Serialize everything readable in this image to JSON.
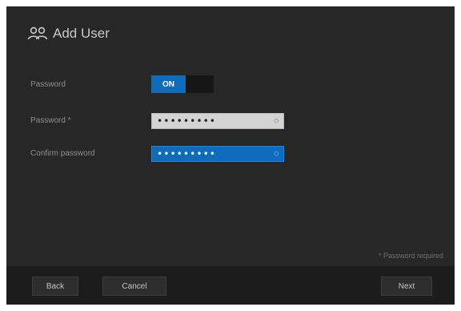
{
  "dialog": {
    "title": "Add User",
    "title_icon": "users-icon",
    "background": "#272727"
  },
  "form": {
    "password_toggle": {
      "label": "Password",
      "on_label": "ON",
      "off_label": "",
      "state": "on"
    },
    "password": {
      "label": "Password *",
      "value": "•••••••••"
    },
    "confirm_password": {
      "label": "Confirm password",
      "value": "•••••••••"
    }
  },
  "note": "* Password required",
  "footer": {
    "back_label": "Back",
    "cancel_label": "Cancel",
    "next_label": "Next"
  },
  "colors": {
    "accent": "#0f6cbd",
    "field_light": "#d4d4d4"
  }
}
